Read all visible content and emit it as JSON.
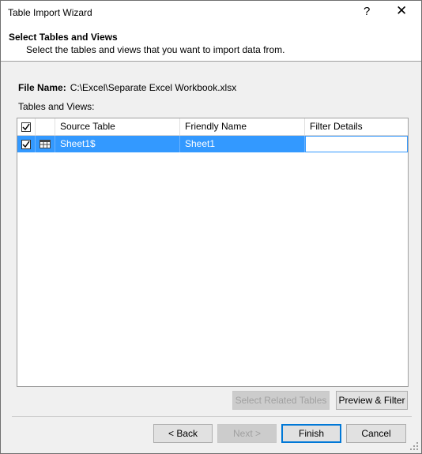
{
  "window": {
    "title": "Table Import Wizard",
    "help_glyph": "?",
    "close_glyph": "✕"
  },
  "header": {
    "title": "Select Tables and Views",
    "subtitle": "Select the tables and views that you want to import data from."
  },
  "file": {
    "label": "File Name:",
    "value": "C:\\Excel\\Separate Excel Workbook.xlsx"
  },
  "tables_label": "Tables and Views:",
  "grid": {
    "columns": [
      "Source Table",
      "Friendly Name",
      "Filter Details"
    ],
    "rows": [
      {
        "checked": true,
        "icon": "table-icon",
        "source": "Sheet1$",
        "friendly": "Sheet1",
        "filter": ""
      }
    ]
  },
  "buttons": {
    "select_related": "Select Related Tables",
    "preview_filter": "Preview & Filter",
    "back": "< Back",
    "next": "Next >",
    "finish": "Finish",
    "cancel": "Cancel"
  },
  "colors": {
    "selection": "#3399ff",
    "default_button_border": "#0078d7"
  }
}
